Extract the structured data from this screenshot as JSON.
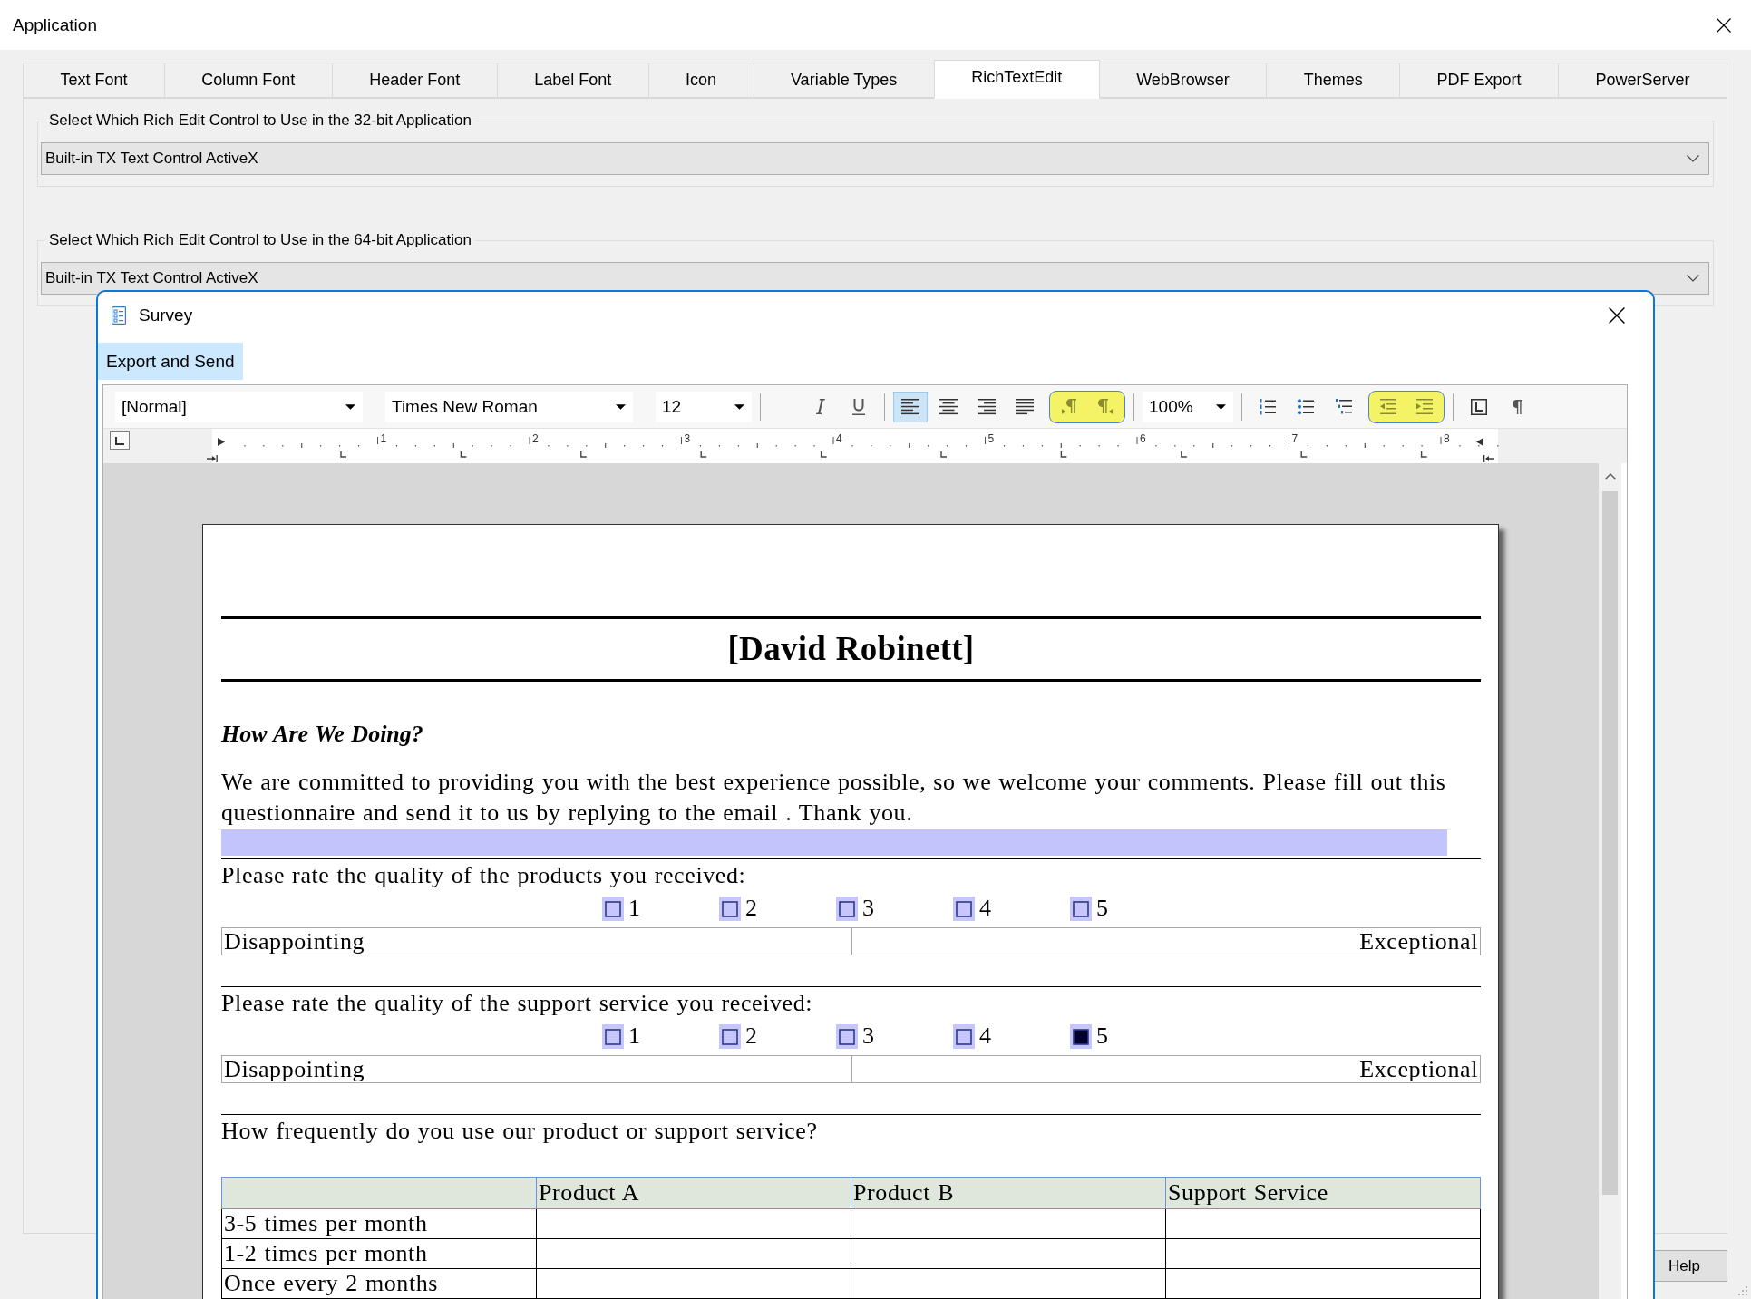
{
  "window": {
    "title": "Application"
  },
  "tabs": [
    {
      "label": "Text Font",
      "selected": false
    },
    {
      "label": "Column Font",
      "selected": false
    },
    {
      "label": "Header Font",
      "selected": false
    },
    {
      "label": "Label Font",
      "selected": false
    },
    {
      "label": "Icon",
      "selected": false
    },
    {
      "label": "Variable Types",
      "selected": false
    },
    {
      "label": "RichTextEdit",
      "selected": true
    },
    {
      "label": "WebBrowser",
      "selected": false
    },
    {
      "label": "Themes",
      "selected": false
    },
    {
      "label": "PDF Export",
      "selected": false
    },
    {
      "label": "PowerServer",
      "selected": false
    }
  ],
  "groups": [
    {
      "label": "Select Which Rich Edit Control to Use in the 32-bit Application",
      "value": "Built-in TX Text Control ActiveX"
    },
    {
      "label": "Select Which Rich Edit Control to Use in the 64-bit Application",
      "value": "Built-in TX Text Control ActiveX"
    }
  ],
  "help_button": {
    "label": "Help"
  },
  "survey": {
    "title": "Survey",
    "menu": [
      {
        "label": "Export and Send",
        "selected": true
      }
    ],
    "toolbar": [
      {
        "items": [
          {
            "kind": "style",
            "value": "[Normal]"
          },
          {
            "kind": "font",
            "value": "Times New Roman"
          },
          {
            "kind": "size",
            "value": "12"
          }
        ]
      },
      {
        "items": [
          {
            "kind": "italic"
          },
          {
            "kind": "underline"
          }
        ]
      },
      {
        "items": [
          {
            "kind": "align_left",
            "selected": true
          },
          {
            "kind": "align_center",
            "selected": false
          },
          {
            "kind": "align_right",
            "selected": false
          },
          {
            "kind": "justify",
            "selected": false
          },
          {
            "kind": "group",
            "highlighted": true,
            "items": [
              {
                "kind": "ltr_paragraph"
              },
              {
                "kind": "rtl_paragraph"
              }
            ]
          }
        ]
      },
      {
        "items": [
          {
            "kind": "zoom",
            "value": "100%"
          }
        ]
      },
      {
        "items": [
          {
            "kind": "numbered_list"
          },
          {
            "kind": "bulleted_list"
          },
          {
            "kind": "multilevel_list"
          },
          {
            "kind": "group",
            "highlighted": true,
            "items": [
              {
                "kind": "decrease_indent"
              },
              {
                "kind": "increase_indent"
              }
            ]
          }
        ]
      },
      {
        "items": [
          {
            "kind": "frame"
          },
          {
            "kind": "pilcrow"
          }
        ]
      }
    ],
    "ruler": {
      "labels": [
        "1",
        "2",
        "3",
        "4",
        "5",
        "6",
        "7",
        "8"
      ]
    },
    "document": {
      "title": "[David Robinett]",
      "heading": "How Are We Doing?",
      "intro": "We are committed to providing you with the best experience possible, so we welcome your comments. Please fill out this questionnaire and send it to us by replying to the email . Thank you.",
      "questions": [
        {
          "kind": "rating",
          "prompt": "Please rate the quality of the products you received:",
          "options": [
            {
              "label": "1",
              "checked": false
            },
            {
              "label": "2",
              "checked": false
            },
            {
              "label": "3",
              "checked": false
            },
            {
              "label": "4",
              "checked": false
            },
            {
              "label": "5",
              "checked": false
            }
          ],
          "low_label": "Disappointing",
          "high_label": "Exceptional"
        },
        {
          "kind": "rating",
          "prompt": "Please rate the quality of the support service you received:",
          "options": [
            {
              "label": "1",
              "checked": false
            },
            {
              "label": "2",
              "checked": false
            },
            {
              "label": "3",
              "checked": false
            },
            {
              "label": "4",
              "checked": false
            },
            {
              "label": "5",
              "checked": true
            }
          ],
          "low_label": "Disappointing",
          "high_label": "Exceptional"
        },
        {
          "kind": "grid",
          "prompt": "How frequently do you use our product or support service?",
          "columns": [
            "Product A",
            "Product B",
            "Support Service"
          ],
          "rows": [
            "3-5 times per month",
            "1-2 times per month",
            "Once every 2 months"
          ]
        }
      ]
    }
  }
}
